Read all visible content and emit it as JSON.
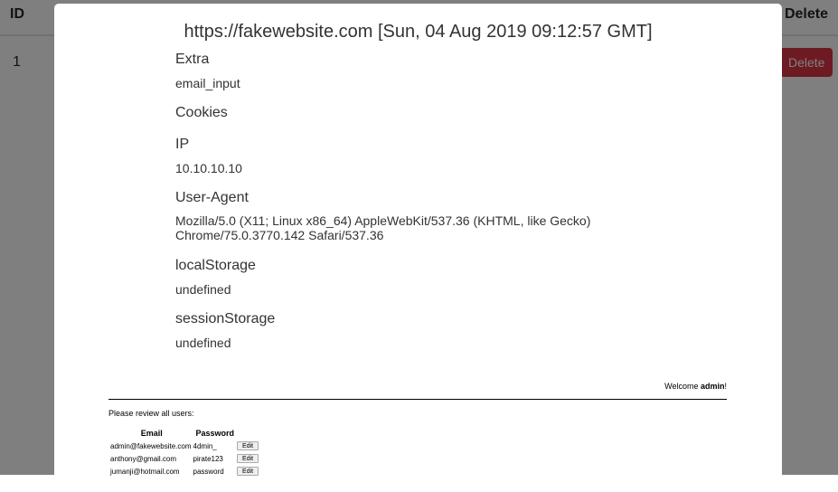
{
  "background_table": {
    "header_id": "ID",
    "header_delete": "Delete",
    "row_id": "1",
    "delete_button": "Delete"
  },
  "modal": {
    "title": "https://fakewebsite.com [Sun, 04 Aug 2019 09:12:57 GMT]",
    "fields": [
      {
        "label": "Extra",
        "value": "email_input"
      },
      {
        "label": "Cookies",
        "value": ""
      },
      {
        "label": "IP",
        "value": "10.10.10.10"
      },
      {
        "label": "User-Agent",
        "value": "Mozilla/5.0 (X11; Linux x86_64) AppleWebKit/537.36 (KHTML, like Gecko) Chrome/75.0.3770.142 Safari/537.36"
      },
      {
        "label": "localStorage",
        "value": "undefined"
      },
      {
        "label": "sessionStorage",
        "value": "undefined"
      }
    ],
    "screenshot": {
      "welcome_prefix": "Welcome ",
      "welcome_user": "admin",
      "welcome_suffix": "!",
      "review_text": "Please review all users:",
      "columns": [
        "Email",
        "Password"
      ],
      "rows": [
        {
          "email": "admin@fakewebsite.com",
          "password": "4dmin_",
          "edit": "Edit"
        },
        {
          "email": "anthony@gmail.com",
          "password": "pirate123",
          "edit": "Edit"
        },
        {
          "email": "jumanji@hotmail.com",
          "password": "password",
          "edit": "Edit"
        }
      ]
    }
  }
}
